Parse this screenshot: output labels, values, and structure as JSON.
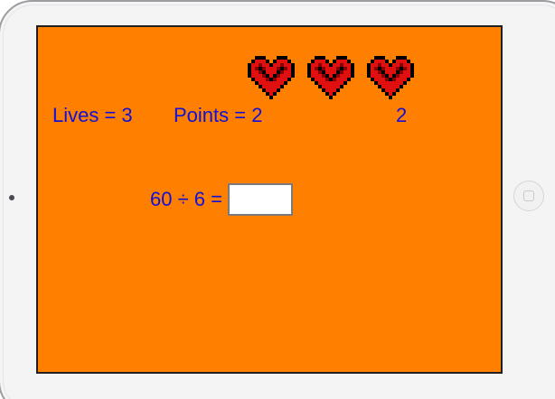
{
  "hud": {
    "lives_text": "Lives = 3",
    "points_text": "Points = 2",
    "stage_value": "2",
    "lives_count": 3
  },
  "hearts": [
    {
      "icon": "pixel-heart-icon"
    },
    {
      "icon": "pixel-heart-icon"
    },
    {
      "icon": "pixel-heart-icon"
    }
  ],
  "question": {
    "text": "60 ÷ 6 =",
    "answer_value": ""
  },
  "colors": {
    "background": "#ff8000",
    "text": "#1010d8",
    "heart_fill": "#e01010",
    "heart_outline": "#000000"
  }
}
